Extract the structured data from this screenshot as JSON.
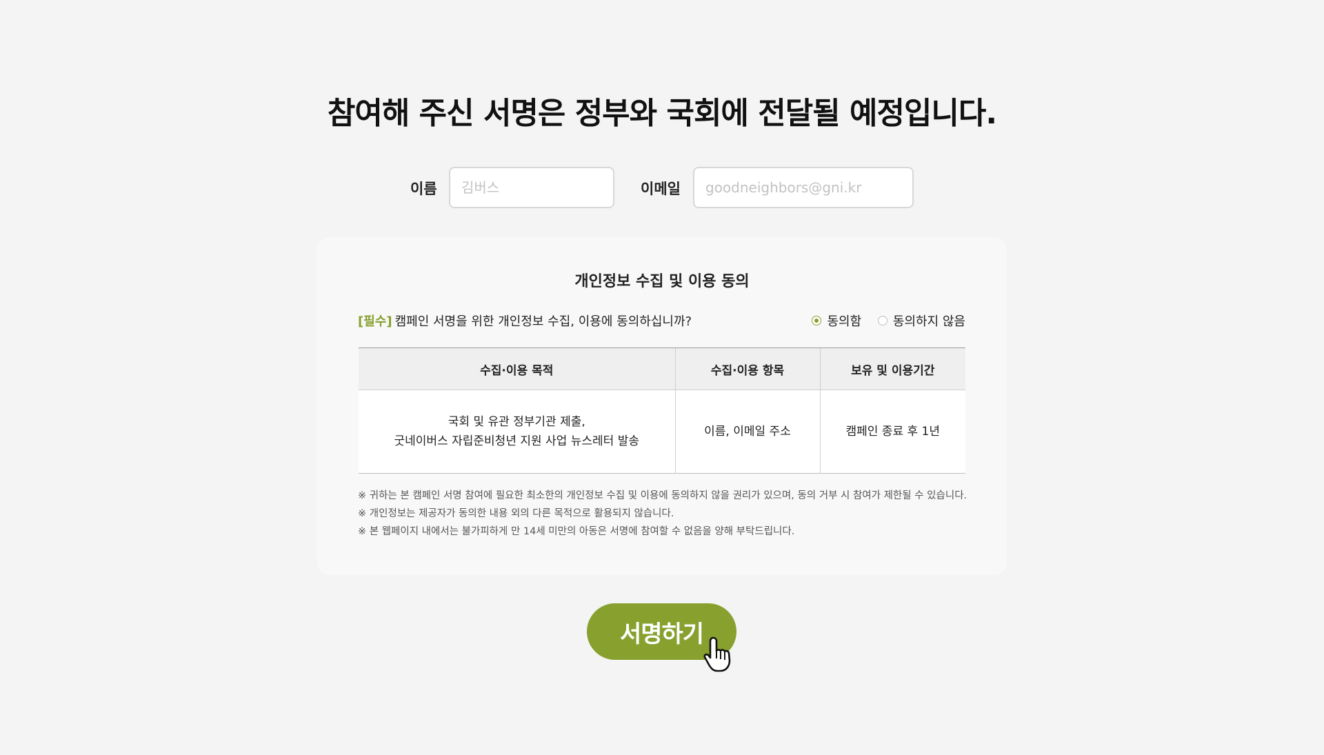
{
  "headline": "참여해 주신 서명은 정부와 국회에 전달될 예정입니다.",
  "form": {
    "name_label": "이름",
    "name_placeholder": "김버스",
    "email_label": "이메일",
    "email_placeholder": "goodneighbors@gni.kr"
  },
  "consent": {
    "title": "개인정보 수집 및 이용 동의",
    "required_tag": "[필수]",
    "question": "캠페인 서명을 위한 개인정보 수집, 이용에 동의하십니까?",
    "options": [
      {
        "label": "동의함",
        "checked": true
      },
      {
        "label": "동의하지 않음",
        "checked": false
      }
    ],
    "table": {
      "headers": [
        "수집·이용 목적",
        "수집·이용 항목",
        "보유 및 이용기간"
      ],
      "row": {
        "purpose_line1": "국회 및 유관 정부기관 제출,",
        "purpose_line2": "굿네이버스 자립준비청년 지원 사업 뉴스레터 발송",
        "items": "이름, 이메일 주소",
        "period": "캠페인 종료 후 1년"
      }
    },
    "notes": [
      "※ 귀하는 본 캠페인 서명 참여에 필요한 최소한의 개인정보 수집 및 이용에 동의하지 않을 권리가 있으며, 동의 거부 시 참여가 제한될 수 있습니다.",
      "※ 개인정보는 제공자가 동의한 내용 외의 다른 목적으로 활용되지 않습니다.",
      "※ 본 웹페이지 내에서는 불가피하게 만 14세 미만의 아동은 서명에 참여할 수 없음을 양해 부탁드립니다."
    ]
  },
  "submit_label": "서명하기",
  "colors": {
    "accent": "#87a02e",
    "background": "#f4f4f4",
    "box": "#f8f8f8"
  },
  "icons": {
    "cursor": "hand-pointer-icon"
  }
}
